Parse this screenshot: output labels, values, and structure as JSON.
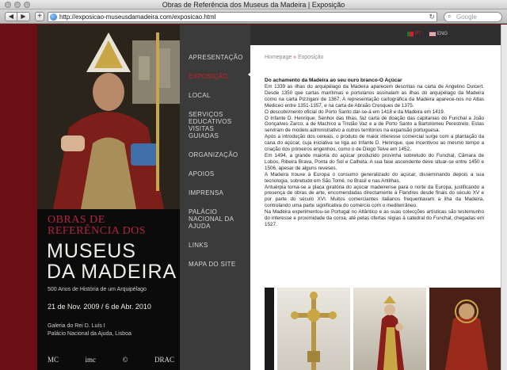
{
  "browser": {
    "window_title": "Obras de Referência dos Museus da Madeira | Exposição",
    "url": "http://exposicao-museusdamadeira.com/exposicao.html",
    "search_placeholder": "Google",
    "back": "◀",
    "forward": "▶",
    "new_tab": "+",
    "reload": "↻",
    "search_icon": "⌕"
  },
  "lang": [
    {
      "label": "PT",
      "color": "#d21f2b"
    },
    {
      "label": "ENG",
      "color": "#cccccc"
    }
  ],
  "brand": {
    "obras_line1": "OBRAS DE",
    "obras_line2": "REFERÊNCIA DOS",
    "museus_line1": "MUSEUS",
    "museus_line2": "DA MADEIRA",
    "subtitle": "500 Anos de História de um Arquipélago",
    "dates": "21 de Nov. 2009 / 6 de Abr. 2010",
    "venue_line1": "Galeria do Rei D. Luís I",
    "venue_line2": "Palácio Nacional da Ajuda, Lisboa",
    "logos": [
      "MC",
      "imc",
      "©",
      "DRAC"
    ]
  },
  "menu": [
    {
      "label": "APRESENTAÇÃO"
    },
    {
      "label": "EXPOSIÇÃO",
      "active": true
    },
    {
      "label": "LOCAL"
    },
    {
      "label": "SERVIÇOS EDUCATIVOS VISITAS GUIADAS"
    },
    {
      "label": "ORGANIZAÇÃO"
    },
    {
      "label": "APOIOS"
    },
    {
      "label": "IMPRENSA"
    },
    {
      "label": "PALÁCIO NACIONAL DA AJUDA"
    },
    {
      "label": "LINKS"
    },
    {
      "label": "MAPA DO SITE"
    }
  ],
  "breadcrumb": {
    "home": "Homepage",
    "sep": "»",
    "current": "Exposição"
  },
  "article": {
    "title": "Do achamento da Madeira ao seu ouro branco-O Açúcar",
    "p1": "Em 1339 as ilhas do arquipélago da Madeira aparecem descritas na carta de Angelino Dulcert. Desde 1350 que cartas marítimas e portulanos assinalam as ilhas do arquipélago da Madeira como na carta Pizzigani de 1367. A representação cartográfica da Madeira aparece-nos no Atlas Mediceo entre 1351-1357, e na carta de Abraão Cresques de 1375.",
    "p2_prefix": "O ",
    "p2_em": "descobrimento",
    "p2_rest": " oficial do Porto Santo dar-se-á em 1418 e da Madeira em 1419.",
    "p3": "O Infante D. Henrique, Senhor das Ilhas, faz carta de doação das capitanias do Funchal a João Gonçalves Zarco, a de Machico a Tristão Vaz e a de Porto Santo a Bartolomeu Perestrelo. Estas serviram de modelo administrativo a outros territórios na expansão portuguesa.",
    "p4": "Após a introdução dos cereais, o produto de maior interesse comercial surge com a plantação da cana do açúcar, cuja iniciativa se liga ao Infante D. Henrique, que incentivou ao mesmo tempo a criação dos primeiros engenhos, como o de Diogo Teive em 1452.",
    "p5": "Em 1494, a grande maioria do açúcar produzido provinha sobretudo do Funchal, Câmara de Lobos, Ribeira Brava, Ponta do Sol e Calheta. A sua fase ascendente deve situar-se entre 1450 e 1506, apesar de alguns reveses.",
    "p6": "A Madeira trouxe à Europa o consumo generalizado do açúcar, disseminando depois a sua tecnologia, sobretudo em São Tomé, no Brasil e nas Antilhas.",
    "p7": "Antuérpia torna-se a placa giratória do açúcar madeirense para o norte da Europa, justificando a presença de obras de arte, encomendadas directamente à Flandres desde finais do século XV e por parte do século XVI. Muitos comerciantes italianos frequentavam a ilha da Madeira, controlando uma parte significativa do comércio com o mediterrâneo.",
    "p8": "Na Madeira experimentou-se Portugal no Atlântico e as suas colecções artísticas são testemunho do interesse e proximidade da coroa, até pelas ofertas régias à catedral do Funchal, chegadas em 1527."
  }
}
